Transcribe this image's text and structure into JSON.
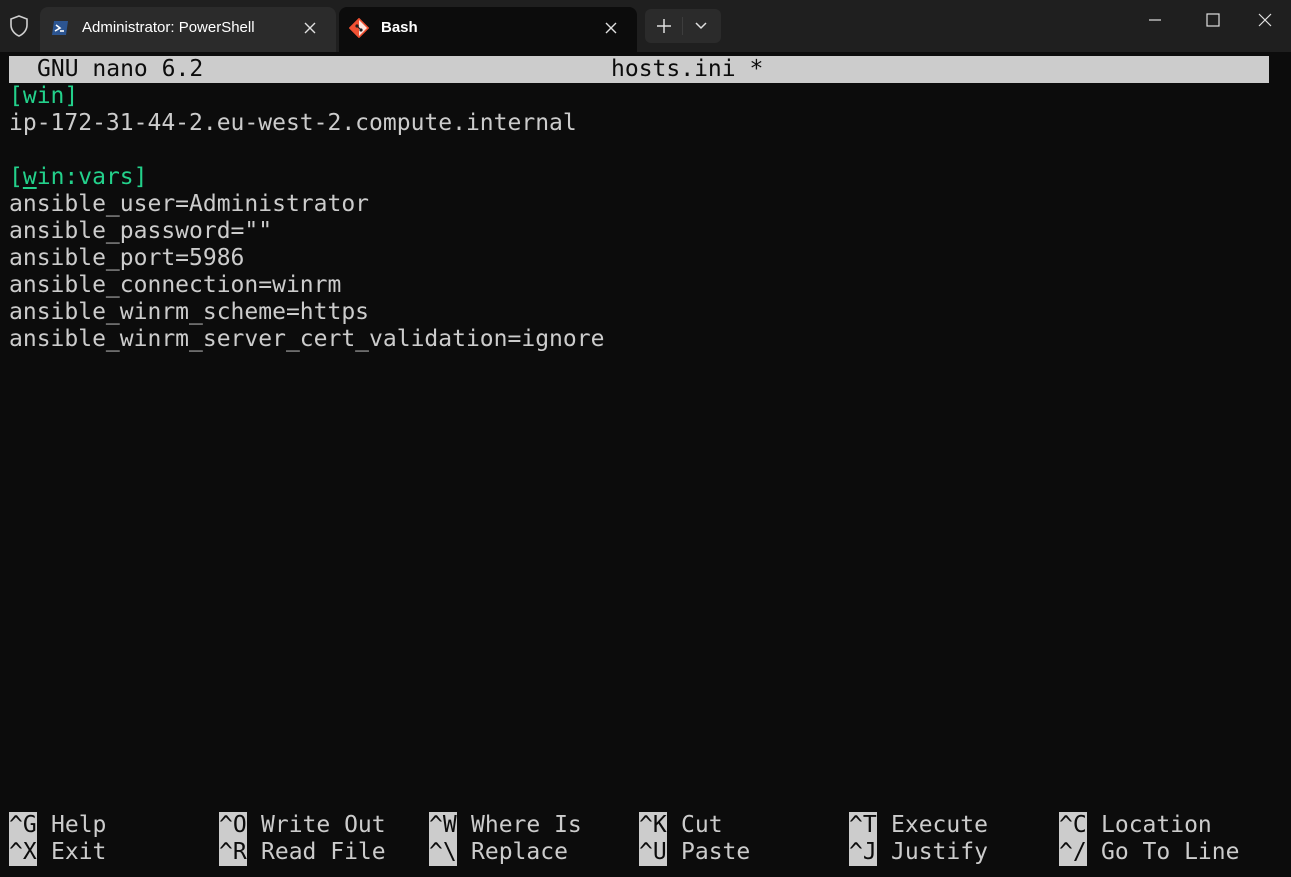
{
  "window": {
    "tabs": [
      {
        "label": "Administrator: PowerShell",
        "active": false,
        "icon": "powershell-icon"
      },
      {
        "label": "Bash",
        "active": true,
        "icon": "git-bash-icon"
      }
    ],
    "new_tab_icon": "plus-icon",
    "dropdown_icon": "chevron-down-icon"
  },
  "nano": {
    "app": "GNU nano 6.2",
    "filename": "hosts.ini *",
    "lines": [
      {
        "pre": "",
        "hl": "[win]",
        "post": "",
        "type": "section"
      },
      {
        "text": "ip-172-31-44-2.eu-west-2.compute.internal",
        "type": "plain"
      },
      {
        "text": "",
        "type": "plain"
      },
      {
        "type": "section-cursor",
        "a": "[",
        "b": "w",
        "c": "in:vars]"
      },
      {
        "text": "ansible_user=Administrator",
        "type": "plain"
      },
      {
        "text": "ansible_password=\"\"",
        "type": "plain"
      },
      {
        "text": "ansible_port=5986",
        "type": "plain"
      },
      {
        "text": "ansible_connection=winrm",
        "type": "plain"
      },
      {
        "text": "ansible_winrm_scheme=https",
        "type": "plain"
      },
      {
        "text": "ansible_winrm_server_cert_validation=ignore",
        "type": "plain"
      }
    ],
    "shortcuts_row1": [
      {
        "key": "^G",
        "label": "Help"
      },
      {
        "key": "^O",
        "label": "Write Out"
      },
      {
        "key": "^W",
        "label": "Where Is"
      },
      {
        "key": "^K",
        "label": "Cut"
      },
      {
        "key": "^T",
        "label": "Execute"
      },
      {
        "key": "^C",
        "label": "Location"
      }
    ],
    "shortcuts_row2": [
      {
        "key": "^X",
        "label": "Exit"
      },
      {
        "key": "^R",
        "label": "Read File"
      },
      {
        "key": "^\\",
        "label": "Replace"
      },
      {
        "key": "^U",
        "label": "Paste"
      },
      {
        "key": "^J",
        "label": "Justify"
      },
      {
        "key": "^/",
        "label": "Go To Line"
      }
    ]
  }
}
